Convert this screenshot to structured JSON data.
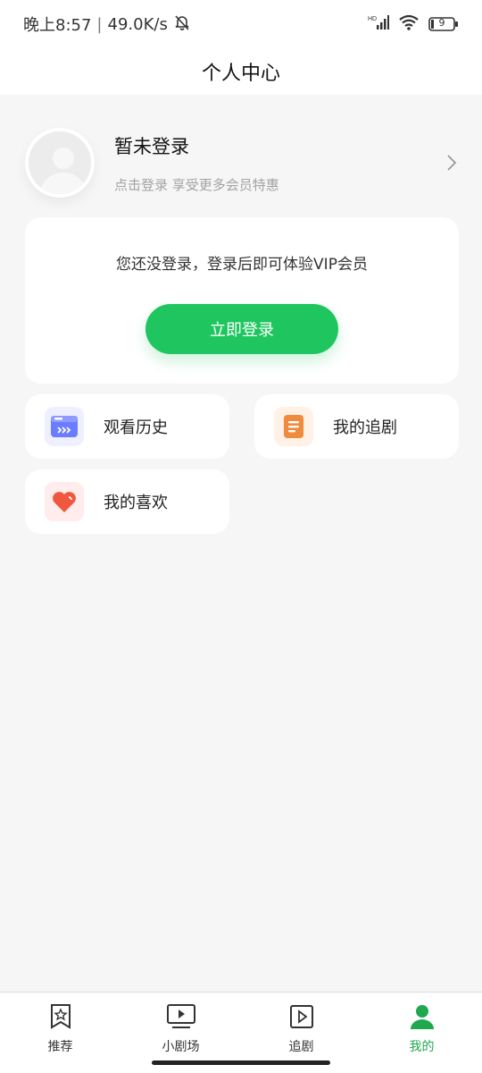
{
  "status_bar": {
    "time": "晚上8:57",
    "speed": "49.0K/s",
    "battery": "9"
  },
  "header": {
    "title": "个人中心"
  },
  "profile": {
    "name": "暂未登录",
    "subtitle": "点击登录 享受更多会员特惠"
  },
  "login_card": {
    "tip": "您还没登录，登录后即可体验VIP会员",
    "button_label": "立即登录"
  },
  "features": [
    {
      "label": "观看历史",
      "icon": "history-icon"
    },
    {
      "label": "我的追剧",
      "icon": "follow-icon"
    },
    {
      "label": "我的喜欢",
      "icon": "heart-icon"
    }
  ],
  "tabbar": {
    "items": [
      {
        "label": "推荐",
        "icon": "bookmark-star-icon"
      },
      {
        "label": "小剧场",
        "icon": "tv-play-icon"
      },
      {
        "label": "追剧",
        "icon": "play-box-icon"
      },
      {
        "label": "我的",
        "icon": "user-icon",
        "active": true
      }
    ]
  },
  "colors": {
    "accent": "#1fc660",
    "active_tab": "#1fa84e",
    "background": "#f6f6f6"
  }
}
